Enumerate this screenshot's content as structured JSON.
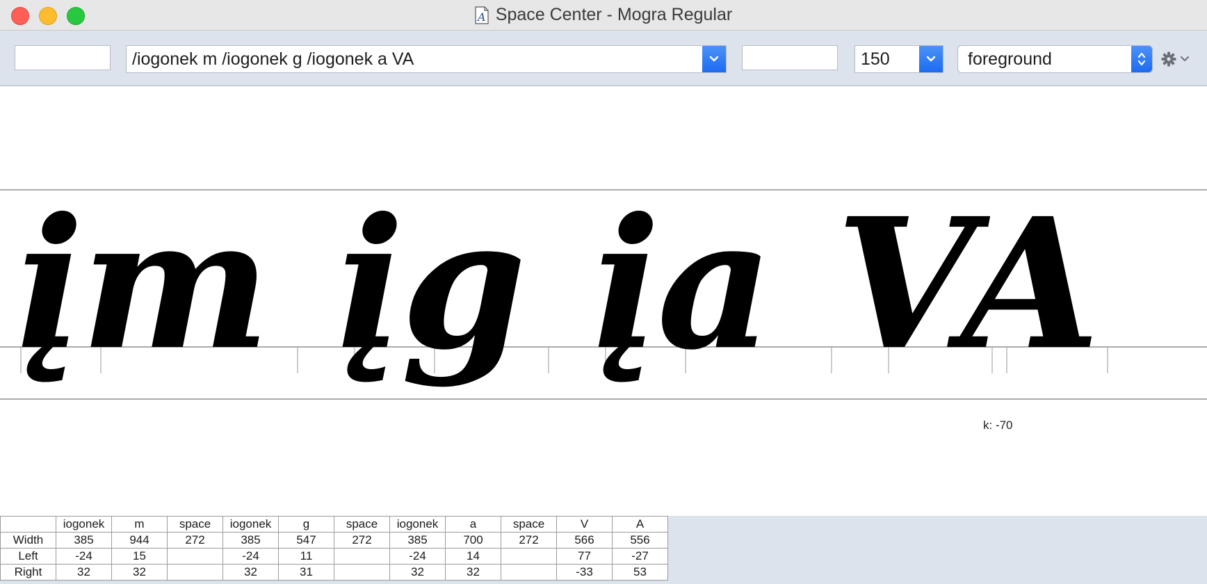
{
  "window": {
    "title": "Space Center - Mogra Regular"
  },
  "toolbar": {
    "left_field_value": "",
    "text_input_value": "/iogonek m /iogonek g /iogonek a VA",
    "pre_field_value": "",
    "size_value": "150",
    "layer_value": "foreground",
    "icons": [
      "chevron-down-icon",
      "updown-arrows-icon",
      "gear-icon"
    ]
  },
  "canvas": {
    "preview_text": "įm įg įa VA",
    "kern_label": "k: -70"
  },
  "metrics": {
    "glyph_names": [
      "iogonek",
      "m",
      "space",
      "iogonek",
      "g",
      "space",
      "iogonek",
      "a",
      "space",
      "V",
      "A"
    ],
    "rows": [
      {
        "label": "Width",
        "values": [
          "385",
          "944",
          "272",
          "385",
          "547",
          "272",
          "385",
          "700",
          "272",
          "566",
          "556"
        ]
      },
      {
        "label": "Left",
        "values": [
          "-24",
          "15",
          "",
          "-24",
          "11",
          "",
          "-24",
          "14",
          "",
          "77",
          "-27"
        ]
      },
      {
        "label": "Right",
        "values": [
          "32",
          "32",
          "",
          "32",
          "31",
          "",
          "32",
          "32",
          "",
          "-33",
          "53"
        ]
      }
    ]
  },
  "colors": {
    "accent": "#1d6af1",
    "toolbar_bg": "#dde3ed"
  }
}
